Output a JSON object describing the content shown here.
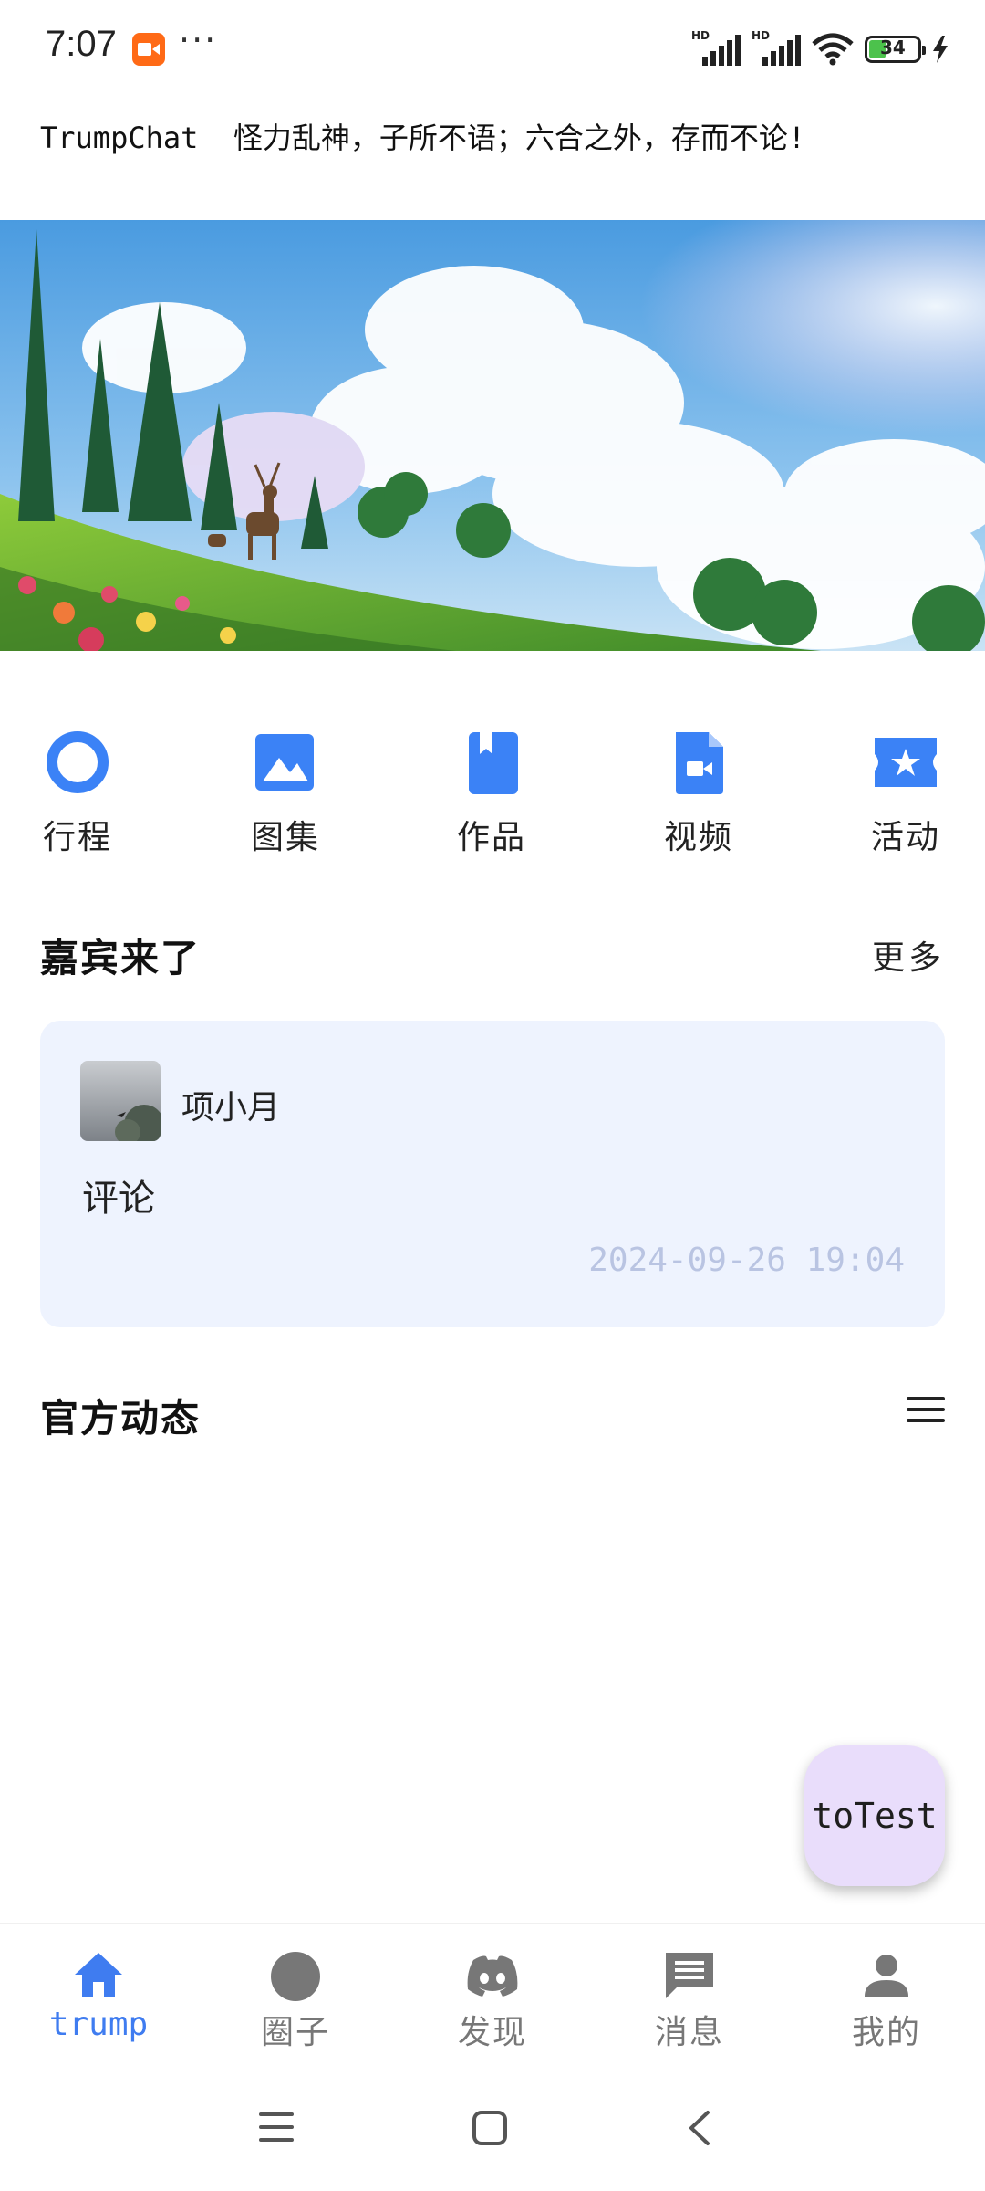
{
  "status_bar": {
    "time": "7:07",
    "battery": "34",
    "icons": [
      "screen-record-icon",
      "more-dots-icon",
      "signal-hd-icon",
      "signal-hd-icon",
      "wifi-icon",
      "battery-icon",
      "charging-icon"
    ]
  },
  "header": {
    "tagline": "TrumpChat  怪力乱神，子所不语；六合之外，存而不论!"
  },
  "banner": {
    "image": "anime-landscape-with-deer-and-clouds"
  },
  "quick_nav": [
    {
      "label": "行程",
      "icon": "circle-ring-icon"
    },
    {
      "label": "图集",
      "icon": "image-icon"
    },
    {
      "label": "作品",
      "icon": "bookmark-book-icon"
    },
    {
      "label": "视频",
      "icon": "video-file-icon"
    },
    {
      "label": "活动",
      "icon": "star-ticket-icon"
    }
  ],
  "guests": {
    "title": "嘉宾来了",
    "more": "更多",
    "card": {
      "name": "项小月",
      "comment": "评论",
      "time": "2024-09-26 19:04"
    }
  },
  "official": {
    "title": "官方动态",
    "menu_icon": "menu-icon"
  },
  "fab": {
    "label": "toTest"
  },
  "bottom_nav": [
    {
      "label": "trump",
      "icon": "home-icon",
      "active": true
    },
    {
      "label": "圈子",
      "icon": "circle-icon",
      "active": false
    },
    {
      "label": "发现",
      "icon": "discord-icon",
      "active": false
    },
    {
      "label": "消息",
      "icon": "message-icon",
      "active": false
    },
    {
      "label": "我的",
      "icon": "person-icon",
      "active": false
    }
  ],
  "colors": {
    "accent": "#3f7cf0",
    "icon_blue": "#3b82f6",
    "card_bg": "#eef3fe",
    "fab_bg": "#e9ddfb",
    "timestamp": "#b9c4e2"
  }
}
